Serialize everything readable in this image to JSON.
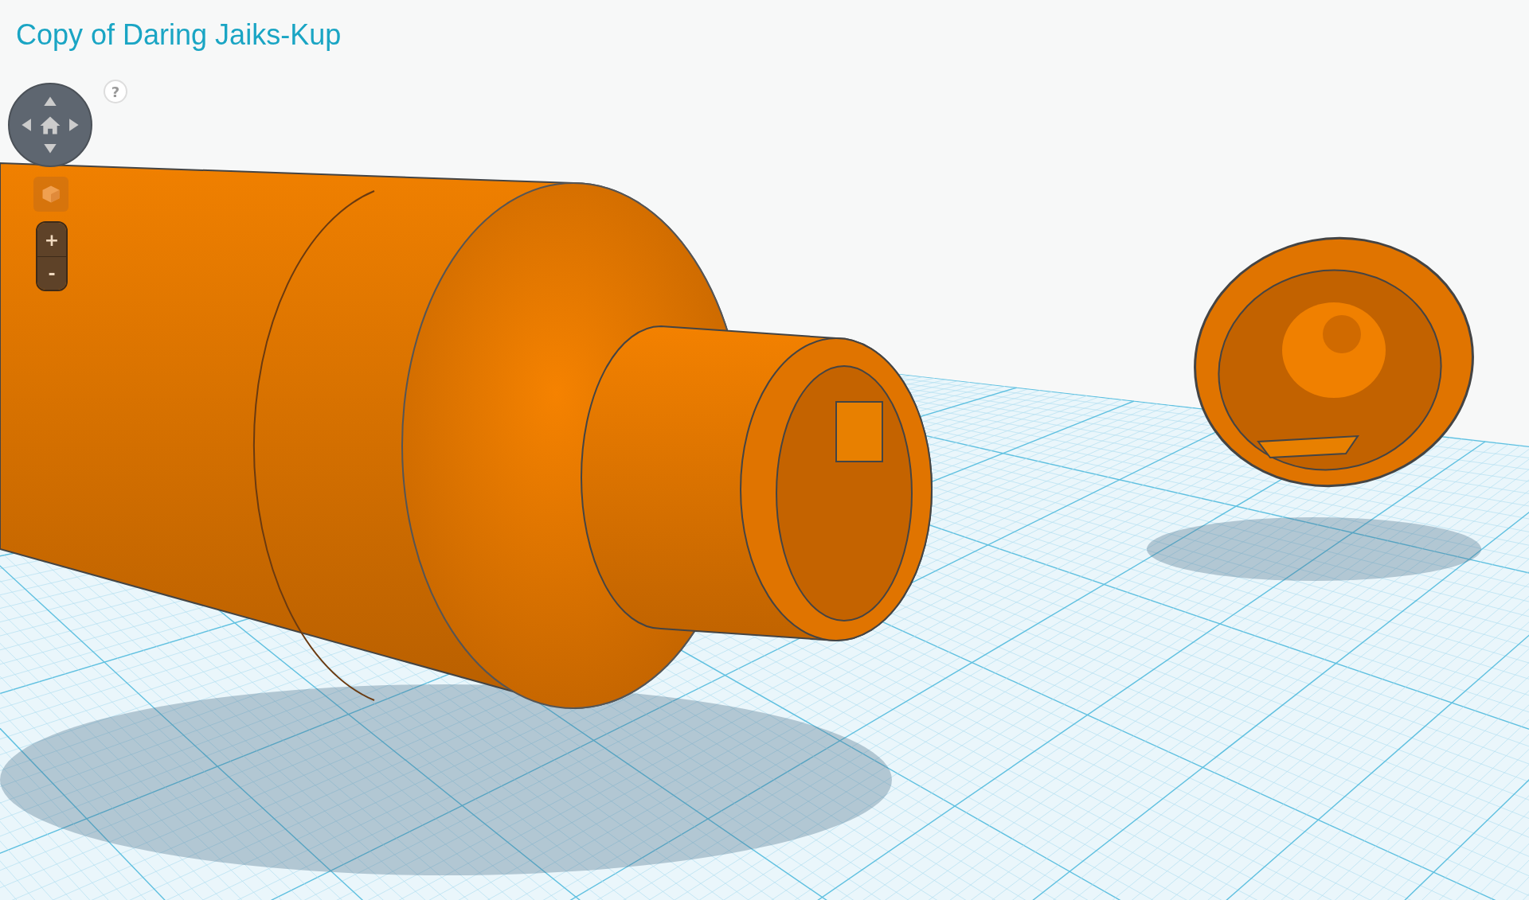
{
  "title": "Copy of Daring Jaiks-Kup",
  "help": "?",
  "zoom_buttons": [
    {
      "label": "+"
    },
    {
      "label": "-"
    }
  ]
}
